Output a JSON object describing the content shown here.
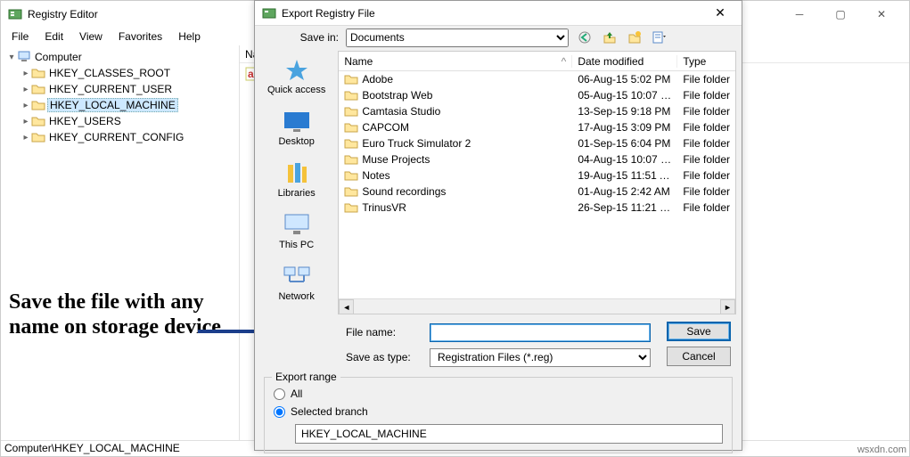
{
  "regedit": {
    "title": "Registry Editor",
    "menu": {
      "file": "File",
      "edit": "Edit",
      "view": "View",
      "favorites": "Favorites",
      "help": "Help"
    },
    "tree": {
      "root": "Computer",
      "nodes": [
        "HKEY_CLASSES_ROOT",
        "HKEY_CURRENT_USER",
        "HKEY_LOCAL_MACHINE",
        "HKEY_USERS",
        "HKEY_CURRENT_CONFIG"
      ]
    },
    "list_header": "Na",
    "status": "Computer\\HKEY_LOCAL_MACHINE"
  },
  "dialog": {
    "title": "Export Registry File",
    "save_in_label": "Save in:",
    "save_in_value": "Documents",
    "places": {
      "quick": "Quick access",
      "desktop": "Desktop",
      "libraries": "Libraries",
      "thispc": "This PC",
      "network": "Network"
    },
    "columns": {
      "name": "Name",
      "date": "Date modified",
      "type": "Type"
    },
    "rows": [
      {
        "name": "Adobe",
        "date": "06-Aug-15 5:02 PM",
        "type": "File folder"
      },
      {
        "name": "Bootstrap Web",
        "date": "05-Aug-15 10:07 P...",
        "type": "File folder"
      },
      {
        "name": "Camtasia Studio",
        "date": "13-Sep-15 9:18 PM",
        "type": "File folder"
      },
      {
        "name": "CAPCOM",
        "date": "17-Aug-15 3:09 PM",
        "type": "File folder"
      },
      {
        "name": "Euro Truck Simulator 2",
        "date": "01-Sep-15 6:04 PM",
        "type": "File folder"
      },
      {
        "name": "Muse Projects",
        "date": "04-Aug-15 10:07 P...",
        "type": "File folder"
      },
      {
        "name": "Notes",
        "date": "19-Aug-15 11:51 A...",
        "type": "File folder"
      },
      {
        "name": "Sound recordings",
        "date": "01-Aug-15 2:42 AM",
        "type": "File folder"
      },
      {
        "name": "TrinusVR",
        "date": "26-Sep-15 11:21 PM",
        "type": "File folder"
      }
    ],
    "file_name_label": "File name:",
    "file_name_value": "",
    "save_type_label": "Save as type:",
    "save_type_value": "Registration Files (*.reg)",
    "save_btn": "Save",
    "cancel_btn": "Cancel",
    "export_range_label": "Export range",
    "radio_all": "All",
    "radio_selected": "Selected branch",
    "branch_value": "HKEY_LOCAL_MACHINE"
  },
  "annotation": "Save the file with any name on storage device",
  "watermark": "wsxdn.com"
}
